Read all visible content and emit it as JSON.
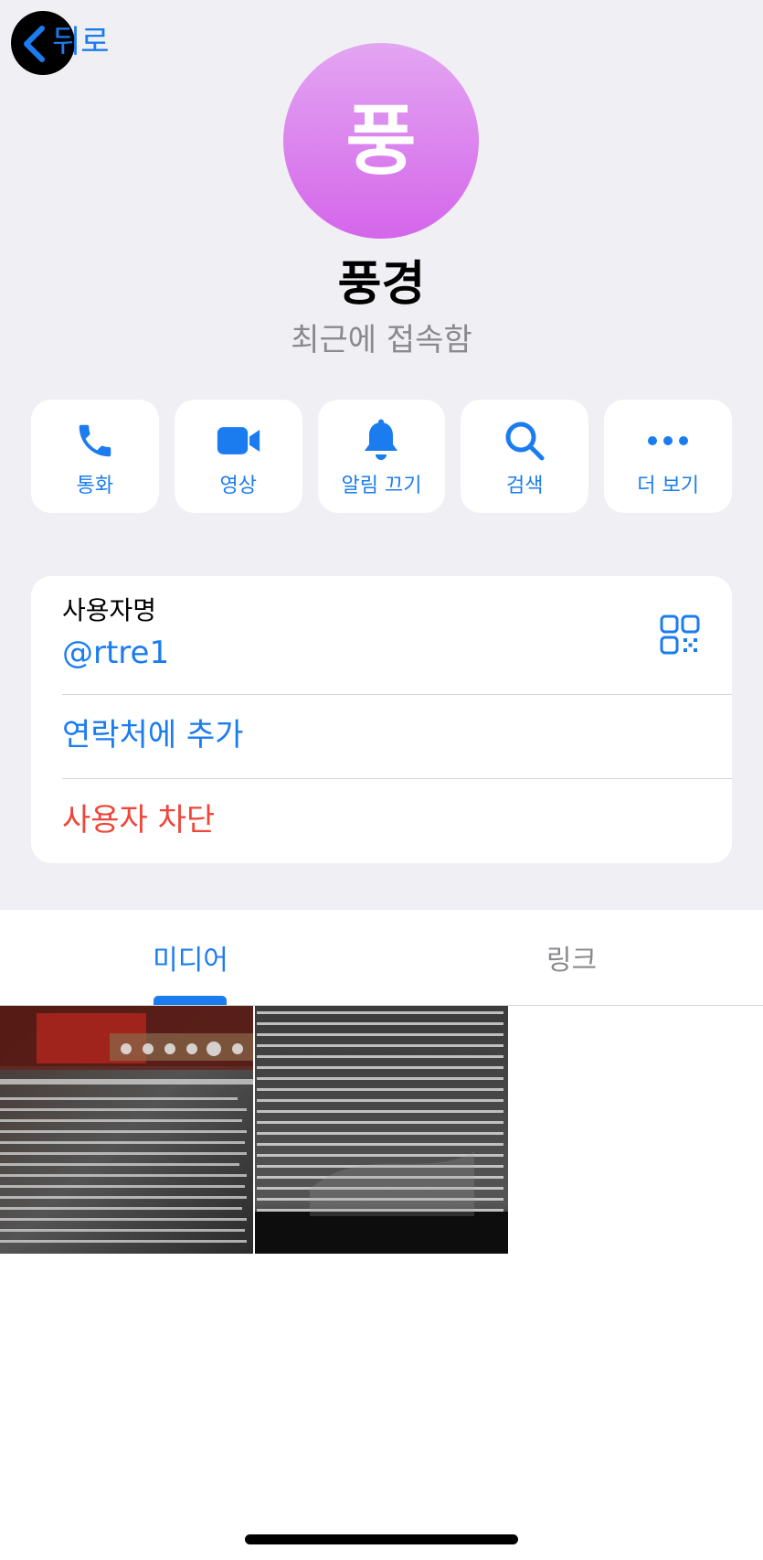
{
  "nav": {
    "back_label": "뒤로",
    "back_icon": "chevron-left-icon"
  },
  "profile": {
    "avatar_letter": "풍",
    "avatar_colors": [
      "#e3a5f2",
      "#d466ea"
    ],
    "name": "풍경",
    "status": "최근에 접속함"
  },
  "actions": [
    {
      "label": "통화",
      "icon": "phone-icon"
    },
    {
      "label": "영상",
      "icon": "video-camera-icon"
    },
    {
      "label": "알림 끄기",
      "icon": "bell-icon"
    },
    {
      "label": "검색",
      "icon": "search-icon"
    },
    {
      "label": "더 보기",
      "icon": "more-icon"
    }
  ],
  "info": {
    "username_label": "사용자명",
    "username_value": "@rtre1",
    "qr_icon": "qr-code-icon",
    "add_contact": "연락처에 추가",
    "block_user": "사용자 차단"
  },
  "tabs": {
    "media": "미디어",
    "links": "링크",
    "active": "media"
  },
  "media_thumbnails": [
    "thumbnail-1",
    "thumbnail-2"
  ],
  "colors": {
    "accent": "#1b7cf0",
    "destructive": "#f0463a",
    "background": "#efeff4"
  }
}
